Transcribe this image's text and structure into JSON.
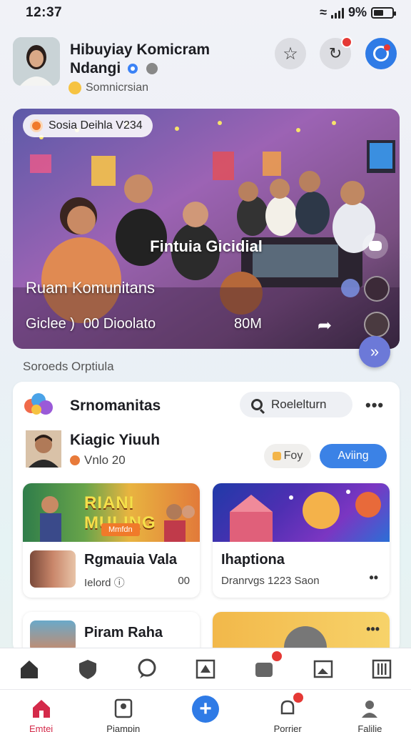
{
  "status": {
    "time": "12:37",
    "battery": "9%"
  },
  "header": {
    "name": "Hibuyiay Komicram Ndangi",
    "subtitle": "Somnicrsian"
  },
  "hero": {
    "tag": "Sosia Deihla V234",
    "title": "Fintuia Gicidial",
    "subtitle": "Ruam Komunitans",
    "stat_left": "Giclee )",
    "stat_mid": "00 Dioolato",
    "count": "80M"
  },
  "section_label": "Soroeds Orptiula",
  "community": {
    "title": "Srnomanitas",
    "search_label": "Roelelturn",
    "member_name": "Kiagic Yiuuh",
    "member_meta": "Vnlo 20",
    "foy_label": "Foy",
    "follow_label": "Aviing",
    "posts": [
      {
        "title": "Rgmauia Vala",
        "meta": "Ielord",
        "right": "00",
        "banner": "RIANI MULING",
        "banner_btn": "Mmfdn"
      },
      {
        "title": "Ihaptiona",
        "meta": "Dranrvgs 1223 Saon"
      },
      {
        "title": "Piram Raha"
      }
    ]
  },
  "bottom_nav": [
    {
      "label": "Emtei",
      "icon": "home-icon"
    },
    {
      "label": "Piampin",
      "icon": "profile-search-icon"
    },
    {
      "label": "",
      "icon": "plus-icon"
    },
    {
      "label": "Porrier",
      "icon": "bell-icon"
    },
    {
      "label": "Falilie",
      "icon": "person-icon"
    }
  ],
  "colors": {
    "accent": "#2f7be6",
    "badge": "#e53935",
    "active": "#d42a4a"
  }
}
